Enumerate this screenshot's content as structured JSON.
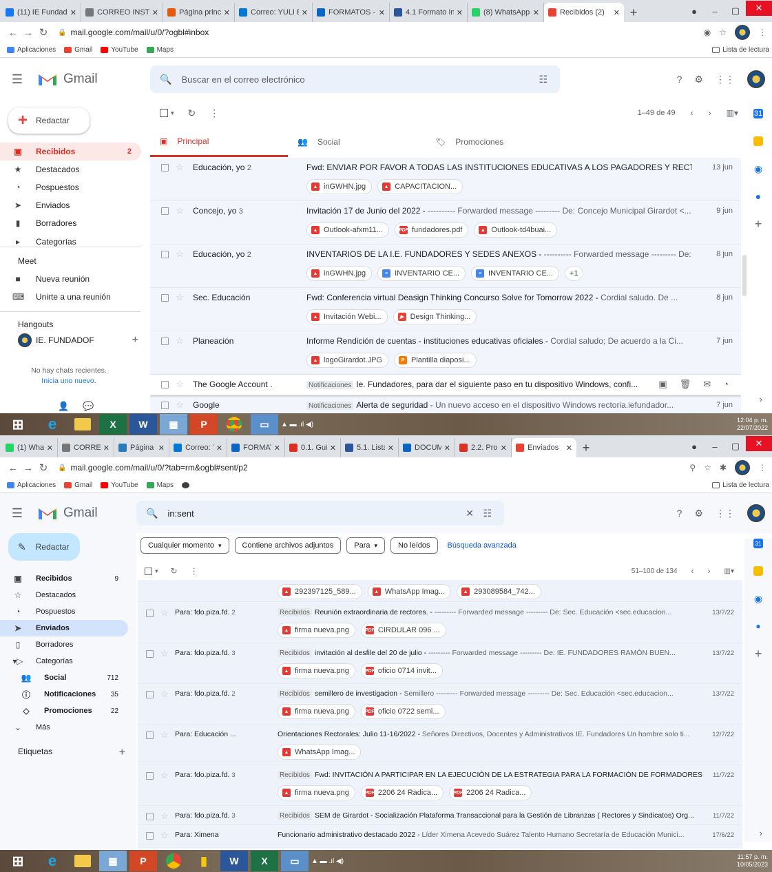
{
  "s1": {
    "tabs": [
      {
        "label": "(11) IE Fundad",
        "color": "#1877f2"
      },
      {
        "label": "CORREO INST",
        "color": "#777777"
      },
      {
        "label": "Página princip",
        "color": "#e8590c"
      },
      {
        "label": "Correo: YULI E",
        "color": "#0078d4"
      },
      {
        "label": "FORMATOS -",
        "color": "#0a66c2"
      },
      {
        "label": "4.1 Formato In",
        "color": "#2b579a"
      },
      {
        "label": "(8) WhatsApp",
        "color": "#25d366"
      },
      {
        "label": "Recibidos (2)",
        "color": "#ea4335"
      }
    ],
    "url": "mail.google.com/mail/u/0/?ogbl#inbox",
    "bookmarks": [
      "Aplicaciones",
      "Gmail",
      "YouTube",
      "Maps"
    ],
    "reading_list": "Lista de lectura",
    "app_name": "Gmail",
    "search_placeholder": "Buscar en el correo electrónico",
    "compose": "Redactar",
    "nav": [
      {
        "label": "Recibidos",
        "count": "2"
      },
      {
        "label": "Destacados",
        "count": ""
      },
      {
        "label": "Pospuestos",
        "count": ""
      },
      {
        "label": "Enviados",
        "count": ""
      },
      {
        "label": "Borradores",
        "count": ""
      },
      {
        "label": "Categorías",
        "count": ""
      }
    ],
    "meet": "Meet",
    "meet_items": [
      "Nueva reunión",
      "Unirte a una reunión"
    ],
    "hangouts": "Hangouts",
    "hangouts_user": "IE. FUNDADOF",
    "no_chats": "No hay chats recientes.",
    "start_new": "Inicia uno nuevo.",
    "pagination": "1–49 de 49",
    "tabs_gmail": [
      "Principal",
      "Social",
      "Promociones"
    ],
    "rows": [
      {
        "sender": "Educación, yo",
        "count": "2",
        "subject": "Fwd: ENVIAR POR FAVOR A TODAS LAS INSTITUCIONES EDUCATIVAS A LOS PAGADORES Y RECTO...",
        "snippet": "",
        "label": "",
        "date": "13 jun",
        "chips": [
          {
            "name": "inGWHN.jpg",
            "t": "img"
          },
          {
            "name": "CAPACITACION...",
            "t": "img"
          }
        ]
      },
      {
        "sender": "Concejo, yo",
        "count": "3",
        "subject": "Invitación 17 de Junio del 2022 -",
        "snippet": " ---------- Forwarded message --------- De: Concejo Municipal Girardot <...",
        "label": "",
        "date": "9 jun",
        "chips": [
          {
            "name": "Outlook-afxm11...",
            "t": "img"
          },
          {
            "name": "fundadores.pdf",
            "t": "pdf"
          },
          {
            "name": "Outlook-td4buai...",
            "t": "img"
          }
        ]
      },
      {
        "sender": "Educación, yo",
        "count": "2",
        "subject": "INVENTARIOS DE LA I.E. FUNDADORES Y SEDES ANEXOS -",
        "snippet": " ---------- Forwarded message --------- De: Sec....",
        "label": "",
        "date": "8 jun",
        "chips": [
          {
            "name": "inGWHN.jpg",
            "t": "img"
          },
          {
            "name": "INVENTARIO CE...",
            "t": "doc"
          },
          {
            "name": "INVENTARIO CE...",
            "t": "doc"
          },
          {
            "name": "+1",
            "t": "more"
          }
        ]
      },
      {
        "sender": "Sec. Educación",
        "count": "",
        "subject": "Fwd: Conferencia virtual Deasign Thinking Concurso Solve for Tomorrow 2022 -",
        "snippet": " Cordial saludo. De ...",
        "label": "",
        "date": "8 jun",
        "chips": [
          {
            "name": "Invitación Webi...",
            "t": "img"
          },
          {
            "name": "Design Thinking...",
            "t": "vid"
          }
        ]
      },
      {
        "sender": "Planeación",
        "count": "",
        "subject": "Informe Rendición de cuentas - instituciones educativas oficiales -",
        "snippet": " Cordial saludo; De acuerdo a la Ci...",
        "label": "",
        "date": "7 jun",
        "chips": [
          {
            "name": "logoGirardot.JPG",
            "t": "img"
          },
          {
            "name": "Plantilla diaposi...",
            "t": "ppt"
          }
        ]
      },
      {
        "sender": "The Google Account .",
        "count": "",
        "subject": "Ie. Fundadores, para dar el siguiente paso en tu dispositivo Windows, confi...",
        "snippet": "",
        "label": "Notificaciones",
        "date": "",
        "chips": []
      },
      {
        "sender": "Google",
        "count": "",
        "subject": "Alerta de seguridad -",
        "snippet": " Un nuevo acceso en el dispositivo Windows rectoria.iefundador...",
        "label": "Notificaciones",
        "date": "7 jun",
        "chips": []
      }
    ],
    "clock_time": "12:04 p. m.",
    "clock_date": "22/07/2022"
  },
  "s2": {
    "tabs": [
      {
        "label": "(1) Whats",
        "color": "#25d366"
      },
      {
        "label": "CORREO",
        "color": "#777777"
      },
      {
        "label": "Página p",
        "color": "#2b7bb9"
      },
      {
        "label": "Correo: Y",
        "color": "#0078d4"
      },
      {
        "label": "FORMAT",
        "color": "#0a66c2"
      },
      {
        "label": "0.1. Guía",
        "color": "#d93025"
      },
      {
        "label": "5.1. Lista",
        "color": "#2b579a"
      },
      {
        "label": "DOCUM",
        "color": "#0a66c2"
      },
      {
        "label": "2.2. Prop",
        "color": "#d93025"
      },
      {
        "label": "Enviados",
        "color": "#ea4335"
      }
    ],
    "url": "mail.google.com/mail/u/0/?tab=rm&ogbl#sent/p2",
    "bookmarks": [
      "Aplicaciones",
      "Gmail",
      "YouTube",
      "Maps"
    ],
    "reading_list": "Lista de lectura",
    "app_name": "Gmail",
    "search_value": "in:sent",
    "compose": "Redactar",
    "filters": [
      "Cualquier momento",
      "Contiene archivos adjuntos",
      "Para",
      "No leídos"
    ],
    "advanced": "Búsqueda avanzada",
    "nav": [
      {
        "label": "Recibidos",
        "count": "9"
      },
      {
        "label": "Destacados",
        "count": ""
      },
      {
        "label": "Pospuestos",
        "count": ""
      },
      {
        "label": "Enviados",
        "count": ""
      },
      {
        "label": "Borradores",
        "count": ""
      },
      {
        "label": "Categorías",
        "count": ""
      },
      {
        "label": "Social",
        "count": "712"
      },
      {
        "label": "Notificaciones",
        "count": "35"
      },
      {
        "label": "Promociones",
        "count": "22"
      },
      {
        "label": "Más",
        "count": ""
      }
    ],
    "labels_head": "Etiquetas",
    "pagination": "51–100 de 134",
    "top_chips": [
      {
        "name": "292397125_589...",
        "t": "img"
      },
      {
        "name": "WhatsApp Imag...",
        "t": "img"
      },
      {
        "name": "293089584_742...",
        "t": "img"
      }
    ],
    "rows": [
      {
        "sender": "Para: fdo.piza.fd.",
        "count": "2",
        "label": "Recibidos",
        "subject": "Reunión extraordinaria de rectores. -",
        "snippet": " --------- Forwarded message --------- De: Sec. Educación <sec.educacion...",
        "date": "13/7/22",
        "chips": [
          {
            "name": "firma nueva.png",
            "t": "img"
          },
          {
            "name": "CIRDULAR 096 ...",
            "t": "pdf"
          }
        ]
      },
      {
        "sender": "Para: fdo.piza.fd.",
        "count": "3",
        "label": "Recibidos",
        "subject": "invitación al desfile del 20 de julio -",
        "snippet": " --------- Forwarded message --------- De: IE. FUNDADORES RAMÓN BUEN...",
        "date": "13/7/22",
        "chips": [
          {
            "name": "firma nueva.png",
            "t": "img"
          },
          {
            "name": "oficio 0714 invit...",
            "t": "pdf"
          }
        ]
      },
      {
        "sender": "Para: fdo.piza.fd.",
        "count": "2",
        "label": "Recibidos",
        "subject": "semillero de investigacion -",
        "snippet": " Semillero --------- Forwarded message --------- De: Sec. Educación <sec.educacion...",
        "date": "13/7/22",
        "chips": [
          {
            "name": "firma nueva.png",
            "t": "img"
          },
          {
            "name": "oficio 0722 semi...",
            "t": "pdf"
          }
        ]
      },
      {
        "sender": "Para: Educación ...",
        "count": "",
        "label": "",
        "subject": "Orientaciones Rectorales: Julio 11-16/2022 -",
        "snippet": " Señores Directivos, Docentes y Administrativos IE. Fundadores Un hombre solo ti...",
        "date": "12/7/22",
        "chips": [
          {
            "name": "WhatsApp Imag...",
            "t": "img"
          }
        ]
      },
      {
        "sender": "Para: fdo.piza.fd.",
        "count": "3",
        "label": "Recibidos",
        "subject": "Fwd: INVITACIÓN A PARTICIPAR EN LA EJECUCIÓN DE LA ESTRATEGIA PARA LA FORMACIÓN DE FORMADORES Y P...",
        "snippet": "",
        "date": "11/7/22",
        "chips": [
          {
            "name": "firma nueva.png",
            "t": "img"
          },
          {
            "name": "2206 24 Radica...",
            "t": "pdf"
          },
          {
            "name": "2206 24 Radica...",
            "t": "pdf"
          }
        ]
      },
      {
        "sender": "Para: fdo.piza.fd.",
        "count": "3",
        "label": "Recibidos",
        "subject": "SEM de Girardot - Socialización Plataforma Transaccional para la Gestión de Libranzas ( Rectores y Sindicatos) Org...",
        "snippet": "",
        "date": "11/7/22",
        "chips": []
      },
      {
        "sender": "Para: Ximena",
        "count": "",
        "label": "",
        "subject": "Funcionario administrativo destacado 2022 -",
        "snippet": " Líder Ximena Acevedo Suárez Talento Humano Secretaría de Educación Munici...",
        "date": "17/6/22",
        "chips": []
      }
    ],
    "clock_time": "11:57 p. m.",
    "clock_date": "10/05/2023"
  }
}
